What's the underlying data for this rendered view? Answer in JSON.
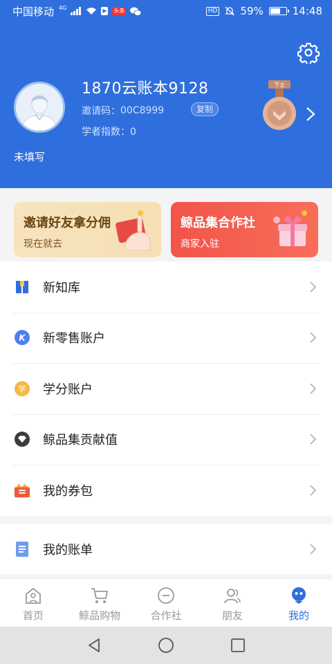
{
  "status_bar": {
    "carrier": "中国移动",
    "network": "4G",
    "toutiao_label": "头条",
    "hd": "HD",
    "battery": "59%",
    "battery_level": 0.59,
    "time": "14:48"
  },
  "profile": {
    "username": "1870云账本9128",
    "invite_label": "邀请码：",
    "invite_code": "00C8999",
    "copy_label": "复制",
    "scholar_index": "学者指数：0",
    "medal_label": "下士",
    "unfilled": "未填写"
  },
  "banners": [
    {
      "title": "邀请好友拿分佣",
      "subtitle": "现在就去"
    },
    {
      "title": "鲸品集合作社",
      "subtitle": "商家入驻"
    }
  ],
  "menu": [
    {
      "label": "新知库",
      "icon": "book-icon"
    },
    {
      "label": "新零售账户",
      "icon": "k-coin-icon"
    },
    {
      "label": "学分账户",
      "icon": "credit-icon",
      "icon_text": "学"
    },
    {
      "label": "鲸品集贡献值",
      "icon": "diamond-icon"
    },
    {
      "label": "我的券包",
      "icon": "coupon-icon"
    },
    {
      "label": "我的账单",
      "icon": "bill-icon"
    }
  ],
  "tabs": [
    {
      "label": "首页",
      "icon": "home-icon"
    },
    {
      "label": "鲸品购物",
      "icon": "cart-icon"
    },
    {
      "label": "合作社",
      "icon": "coop-icon"
    },
    {
      "label": "朋友",
      "icon": "friends-icon"
    },
    {
      "label": "我的",
      "icon": "profile-icon",
      "active": true
    }
  ],
  "colors": {
    "primary": "#2f6fdd",
    "banner_gold": "#f7e4bd",
    "banner_red": "#f2544a"
  }
}
